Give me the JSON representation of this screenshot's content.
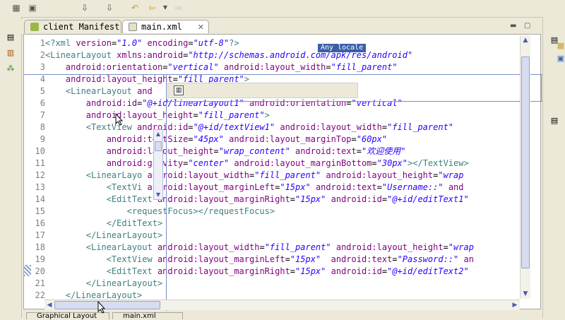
{
  "tabs": [
    {
      "label": "client Manifest",
      "active": false
    },
    {
      "label": "main.xml",
      "active": true
    }
  ],
  "locale_badge": "Any locale",
  "lines": [
    {
      "n": "1",
      "parts": [
        [
          "pi",
          "<?xml "
        ],
        [
          "attr",
          "version"
        ],
        [
          "txt",
          "="
        ],
        [
          "val",
          "\"1.0\""
        ],
        [
          "txt",
          " "
        ],
        [
          "attr",
          "encoding"
        ],
        [
          "txt",
          "="
        ],
        [
          "val",
          "\"utf-8\""
        ],
        [
          "pi",
          "?>"
        ]
      ]
    },
    {
      "n": "2",
      "parts": [
        [
          "tag",
          "<LinearLayout "
        ],
        [
          "attr",
          "xmlns:android"
        ],
        [
          "txt",
          "="
        ],
        [
          "val",
          "\"http://schemas.android.com/apk/res/android\""
        ]
      ]
    },
    {
      "n": "3",
      "parts": [
        [
          "txt",
          "    "
        ],
        [
          "attr",
          "android:orientation"
        ],
        [
          "txt",
          "="
        ],
        [
          "val",
          "\"vertical\""
        ],
        [
          "txt",
          " "
        ],
        [
          "attr",
          "android:layout_width"
        ],
        [
          "txt",
          "="
        ],
        [
          "val",
          "\"fill_parent\""
        ]
      ]
    },
    {
      "n": "4",
      "parts": [
        [
          "txt",
          "    "
        ],
        [
          "attr",
          "android:layout_height"
        ],
        [
          "txt",
          "="
        ],
        [
          "val",
          "\"fill_parent\""
        ],
        [
          "tag",
          ">"
        ]
      ]
    },
    {
      "n": "5",
      "parts": [
        [
          "txt",
          "    "
        ],
        [
          "tag",
          "<LinearLayout "
        ],
        [
          "attr",
          "and"
        ]
      ]
    },
    {
      "n": "6",
      "parts": [
        [
          "txt",
          "        "
        ],
        [
          "attr",
          "android:id"
        ],
        [
          "txt",
          "="
        ],
        [
          "val",
          "\"@+id/linearLayout1\""
        ],
        [
          "txt",
          " "
        ],
        [
          "attr",
          "android:orientation"
        ],
        [
          "txt",
          "="
        ],
        [
          "val",
          "\"vertical\""
        ]
      ]
    },
    {
      "n": "7",
      "parts": [
        [
          "txt",
          "        "
        ],
        [
          "attr",
          "android:layout_height"
        ],
        [
          "txt",
          "="
        ],
        [
          "val",
          "\"fill_parent\""
        ],
        [
          "tag",
          ">"
        ]
      ]
    },
    {
      "n": "8",
      "parts": [
        [
          "txt",
          "        "
        ],
        [
          "tag",
          "<TextView "
        ],
        [
          "attr",
          "android:id"
        ],
        [
          "txt",
          "="
        ],
        [
          "val",
          "\"@+id/textView1\""
        ],
        [
          "txt",
          " "
        ],
        [
          "attr",
          "android:layout_width"
        ],
        [
          "txt",
          "="
        ],
        [
          "val",
          "\"fill_parent\""
        ]
      ]
    },
    {
      "n": "9",
      "parts": [
        [
          "txt",
          "            "
        ],
        [
          "attr",
          "android:textSize"
        ],
        [
          "txt",
          "="
        ],
        [
          "val",
          "\"45px\""
        ],
        [
          "txt",
          " "
        ],
        [
          "attr",
          "android:layout_marginTop"
        ],
        [
          "txt",
          "="
        ],
        [
          "val",
          "\"60px\""
        ]
      ]
    },
    {
      "n": "10",
      "parts": [
        [
          "txt",
          "            "
        ],
        [
          "attr",
          "android:layout_height"
        ],
        [
          "txt",
          "="
        ],
        [
          "val",
          "\"wrap_content\""
        ],
        [
          "txt",
          " "
        ],
        [
          "attr",
          "android:text"
        ],
        [
          "txt",
          "="
        ],
        [
          "val",
          "\"欢迎使用\""
        ]
      ]
    },
    {
      "n": "11",
      "parts": [
        [
          "txt",
          "            "
        ],
        [
          "attr",
          "android:gravity"
        ],
        [
          "txt",
          "="
        ],
        [
          "val",
          "\"center\""
        ],
        [
          "txt",
          " "
        ],
        [
          "attr",
          "android:layout_marginBottom"
        ],
        [
          "txt",
          "="
        ],
        [
          "val",
          "\"30px\""
        ],
        [
          "tag",
          "></TextView>"
        ]
      ]
    },
    {
      "n": "12",
      "parts": [
        [
          "txt",
          "        "
        ],
        [
          "tag",
          "<LinearLayo "
        ],
        [
          "attr",
          "android:layout_width"
        ],
        [
          "txt",
          "="
        ],
        [
          "val",
          "\"fill_parent\""
        ],
        [
          "txt",
          " "
        ],
        [
          "attr",
          "android:layout_height"
        ],
        [
          "txt",
          "="
        ],
        [
          "val",
          "\"wrap"
        ]
      ]
    },
    {
      "n": "13",
      "parts": [
        [
          "txt",
          "            "
        ],
        [
          "tag",
          "<TextVi "
        ],
        [
          "attr",
          "android:layout_marginLeft"
        ],
        [
          "txt",
          "="
        ],
        [
          "val",
          "\"15px\""
        ],
        [
          "txt",
          " "
        ],
        [
          "attr",
          "android:text"
        ],
        [
          "txt",
          "="
        ],
        [
          "val",
          "\"Username::\""
        ],
        [
          "txt",
          " "
        ],
        [
          "attr",
          "and"
        ]
      ]
    },
    {
      "n": "14",
      "parts": [
        [
          "txt",
          "            "
        ],
        [
          "tag",
          "<EditText "
        ],
        [
          "attr",
          "android:layout_marginRight"
        ],
        [
          "txt",
          "="
        ],
        [
          "val",
          "\"15px\""
        ],
        [
          "txt",
          " "
        ],
        [
          "attr",
          "android:id"
        ],
        [
          "txt",
          "="
        ],
        [
          "val",
          "\"@+id/editText1\""
        ]
      ]
    },
    {
      "n": "15",
      "parts": [
        [
          "txt",
          "                "
        ],
        [
          "tag",
          "<requestFocus></requestFocus>"
        ]
      ]
    },
    {
      "n": "16",
      "parts": [
        [
          "txt",
          "            "
        ],
        [
          "tag",
          "</EditText>"
        ]
      ]
    },
    {
      "n": "17",
      "parts": [
        [
          "txt",
          "        "
        ],
        [
          "tag",
          "</LinearLayout>"
        ]
      ]
    },
    {
      "n": "18",
      "parts": [
        [
          "txt",
          "        "
        ],
        [
          "tag",
          "<LinearLayout "
        ],
        [
          "attr",
          "android:layout_width"
        ],
        [
          "txt",
          "="
        ],
        [
          "val",
          "\"fill_parent\""
        ],
        [
          "txt",
          " "
        ],
        [
          "attr",
          "android:layout_height"
        ],
        [
          "txt",
          "="
        ],
        [
          "val",
          "\"wrap"
        ]
      ]
    },
    {
      "n": "19",
      "parts": [
        [
          "txt",
          "            "
        ],
        [
          "tag",
          "<TextView "
        ],
        [
          "attr",
          "android:layout_marginLeft"
        ],
        [
          "txt",
          "="
        ],
        [
          "val",
          "\"15px\""
        ],
        [
          "txt",
          "  "
        ],
        [
          "attr",
          "android:text"
        ],
        [
          "txt",
          "="
        ],
        [
          "val",
          "\"Password::\""
        ],
        [
          "txt",
          " "
        ],
        [
          "attr",
          "an"
        ]
      ]
    },
    {
      "n": "20",
      "parts": [
        [
          "txt",
          "            "
        ],
        [
          "tag",
          "<EditText "
        ],
        [
          "attr",
          "android:layout_marginRight"
        ],
        [
          "txt",
          "="
        ],
        [
          "val",
          "\"15px\""
        ],
        [
          "txt",
          " "
        ],
        [
          "attr",
          "android:id"
        ],
        [
          "txt",
          "="
        ],
        [
          "val",
          "\"@+id/editText2\""
        ]
      ]
    },
    {
      "n": "21",
      "parts": [
        [
          "txt",
          "        "
        ],
        [
          "tag",
          "</LinearLayout>"
        ]
      ]
    },
    {
      "n": "22",
      "parts": [
        [
          "txt",
          "    "
        ],
        [
          "tag",
          "</LinearLayout>"
        ]
      ]
    }
  ],
  "bottom_tabs": [
    "Graphical Layout",
    "main.xml"
  ],
  "colors": {
    "tag": "#3f7f7f",
    "attr": "#7f007f",
    "value": "#2a00ff",
    "badge": "#3a5fa8"
  }
}
